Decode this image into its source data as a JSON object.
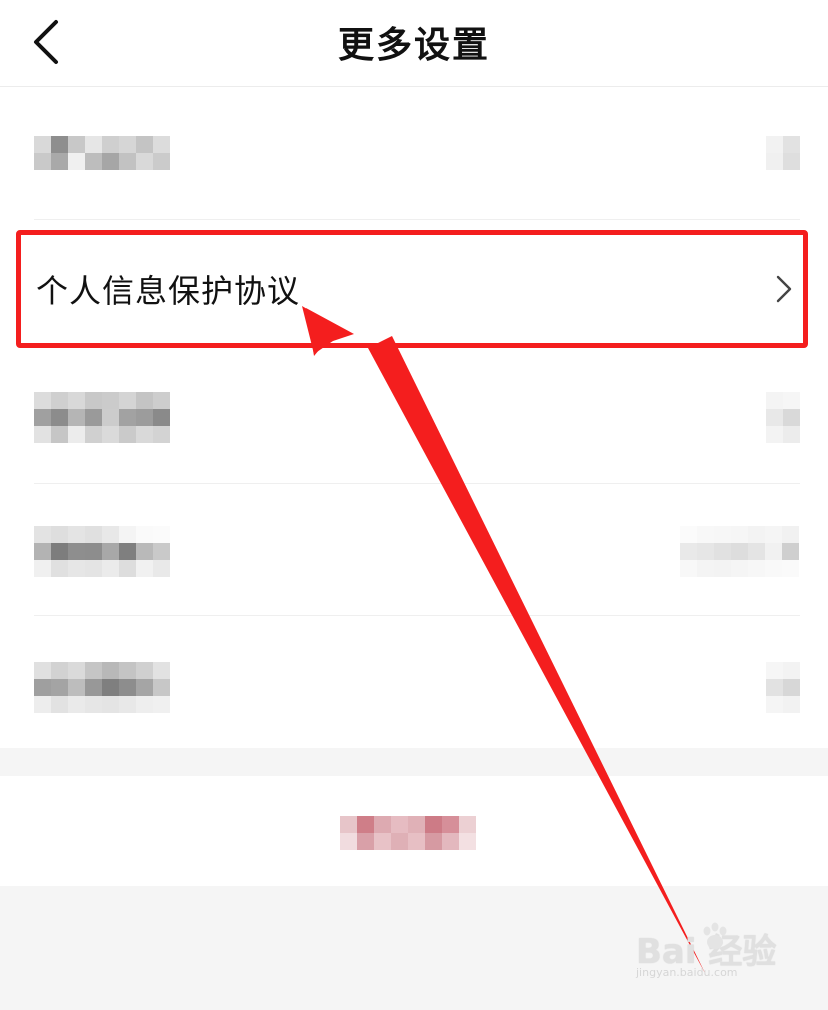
{
  "header": {
    "title": "更多设置",
    "back_icon": "chevron-left-icon"
  },
  "rows": [
    {
      "label": "",
      "obscured": true
    },
    {
      "label": "个人信息保护协议",
      "obscured": false,
      "highlighted": true,
      "trailing_icon": "chevron-right-icon"
    },
    {
      "label": "",
      "obscured": true
    },
    {
      "label": "",
      "obscured": true
    },
    {
      "label": "",
      "obscured": true
    }
  ],
  "footer_action": {
    "label": "",
    "obscured": true
  },
  "annotation": {
    "highlight_color": "#f41e1e",
    "arrow_color": "#f41e1e"
  },
  "watermark": {
    "main": "Bai 经验",
    "sub": "jingyan.baidu.com"
  }
}
